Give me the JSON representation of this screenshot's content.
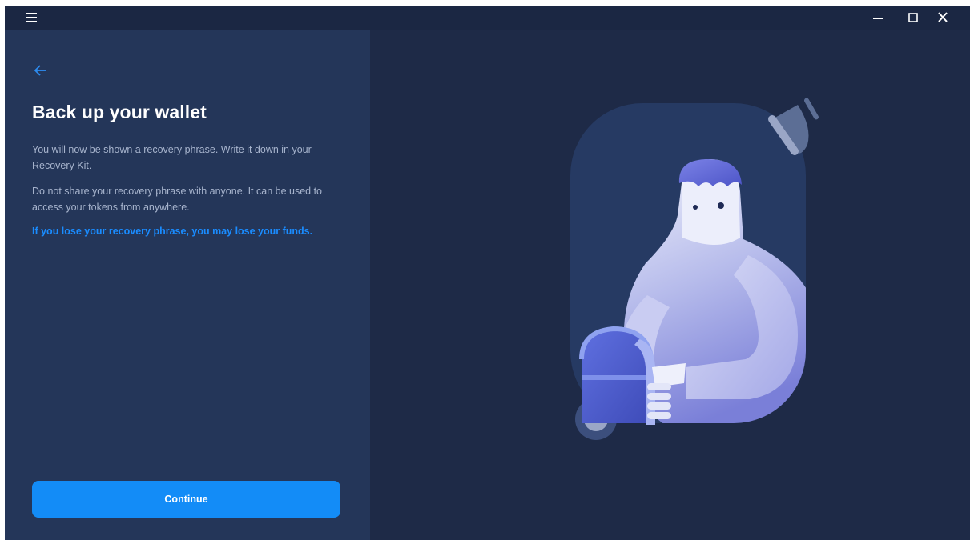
{
  "titlebar": {
    "menu_icon": "hamburger-menu-icon",
    "controls": [
      "minimize-icon",
      "maximize-icon",
      "close-icon"
    ]
  },
  "left_panel": {
    "back_icon": "arrow-left-icon",
    "title": "Back up your wallet",
    "paragraph_1": "You will now be shown a recovery phrase. Write it down in your Recovery Kit.",
    "paragraph_2": "Do not share your recovery phrase with anyone. It can be used to access your tokens from anywhere.",
    "warning": "If you lose your recovery phrase, you may lose your funds.",
    "continue_label": "Continue"
  },
  "illustration": {
    "description_icon": "character-holding-chest-icon"
  },
  "colors": {
    "window_bg": "#1e2a47",
    "panel_bg": "#243659",
    "accent": "#138cf7",
    "warning_text": "#1a8cff",
    "body_text": "#a7b4cd"
  }
}
